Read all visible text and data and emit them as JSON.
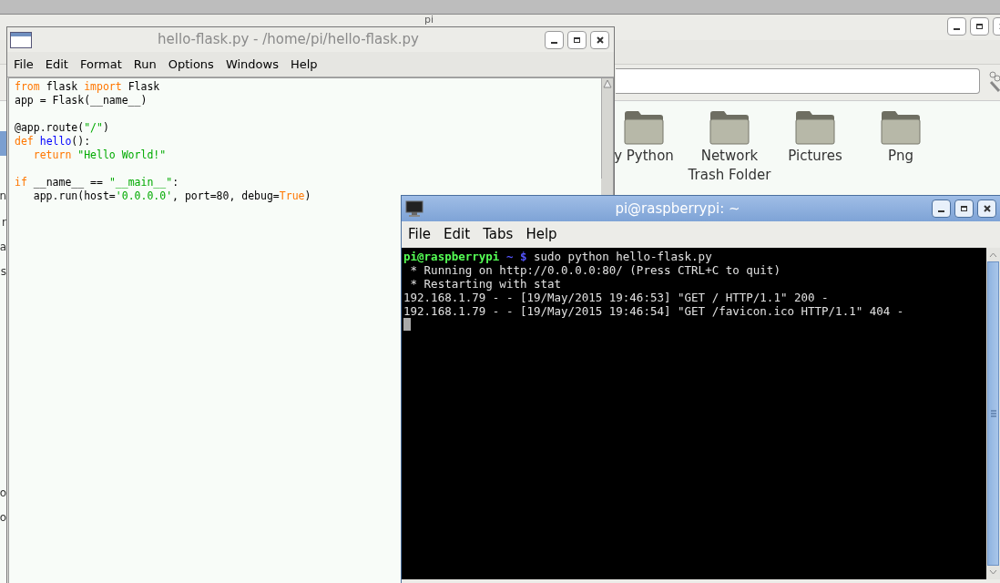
{
  "file_manager": {
    "title": "pi",
    "sidebar_fragments": [
      {
        "selected": true
      },
      {
        "text": "n",
        "selected": false
      },
      {
        "text": "r",
        "selected": false
      },
      {
        "text": "a",
        "selected": false
      },
      {
        "text": "s",
        "selected": false
      },
      {
        "text": "o",
        "selected": false
      },
      {
        "text": "o",
        "selected": false
      }
    ],
    "folders": [
      {
        "label": "y Python"
      },
      {
        "label": "Network Trash Folder"
      },
      {
        "label": "Pictures"
      },
      {
        "label": "Png"
      }
    ]
  },
  "editor": {
    "title": "hello-flask.py - /home/pi/hello-flask.py",
    "menu": [
      "File",
      "Edit",
      "Format",
      "Run",
      "Options",
      "Windows",
      "Help"
    ],
    "code_blocks": [
      [
        {
          "tokens": [
            {
              "kind": "keyword",
              "text": "from"
            },
            {
              "kind": "plain",
              "text": " flask "
            },
            {
              "kind": "keyword",
              "text": "import"
            },
            {
              "kind": "plain",
              "text": " Flask"
            }
          ]
        },
        {
          "tokens": [
            {
              "kind": "plain",
              "text": "app = Flask(__name__)"
            }
          ]
        }
      ],
      [
        {
          "tokens": [
            {
              "kind": "plain",
              "text": "@app.route("
            },
            {
              "kind": "string",
              "text": "\"/\""
            },
            {
              "kind": "plain",
              "text": ")"
            }
          ]
        },
        {
          "tokens": [
            {
              "kind": "keyword",
              "text": "def"
            },
            {
              "kind": "definition",
              "text": " hello"
            },
            {
              "kind": "plain",
              "text": "():"
            }
          ]
        },
        {
          "tokens": [
            {
              "kind": "keyword",
              "text": "   return"
            },
            {
              "kind": "string",
              "text": " \"Hello World!\""
            }
          ]
        }
      ],
      [
        {
          "tokens": [
            {
              "kind": "keyword",
              "text": "if"
            },
            {
              "kind": "plain",
              "text": " __name__ == "
            },
            {
              "kind": "string",
              "text": "\"__main__\""
            },
            {
              "kind": "plain",
              "text": ":"
            }
          ]
        },
        {
          "tokens": [
            {
              "kind": "plain",
              "text": "   app.run(host="
            },
            {
              "kind": "string",
              "text": "'0.0.0.0'"
            },
            {
              "kind": "plain",
              "text": ", port=80, debug="
            },
            {
              "kind": "keyword",
              "text": "True"
            },
            {
              "kind": "plain",
              "text": ")"
            }
          ]
        }
      ]
    ]
  },
  "terminal": {
    "title": "pi@raspberrypi: ~",
    "menu": [
      "File",
      "Edit",
      "Tabs",
      "Help"
    ],
    "lines": [
      [
        {
          "kind": "user",
          "text": "pi@raspberrypi"
        },
        {
          "kind": "path",
          "text": " ~ $"
        },
        {
          "kind": "plain",
          "text": " sudo python hello-flask.py"
        }
      ],
      [
        {
          "kind": "plain",
          "text": " * Running on http://0.0.0.0:80/ (Press CTRL+C to quit)"
        }
      ],
      [
        {
          "kind": "plain",
          "text": " * Restarting with stat"
        }
      ],
      [
        {
          "kind": "plain",
          "text": "192.168.1.79 - - [19/May/2015 19:46:53] \"GET / HTTP/1.1\" 200 -"
        }
      ],
      [
        {
          "kind": "plain",
          "text": "192.168.1.79 - - [19/May/2015 19:46:54] \"GET /favicon.ico HTTP/1.1\" 404 -"
        }
      ]
    ]
  }
}
